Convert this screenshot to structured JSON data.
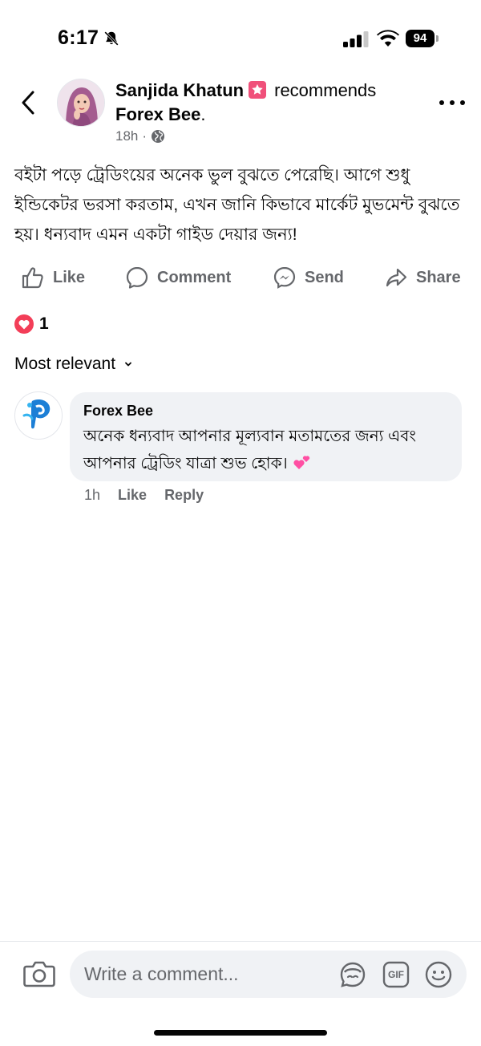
{
  "status_bar": {
    "time": "6:17",
    "battery": "94",
    "icons": [
      "bell-off-icon",
      "signal-icon",
      "wifi-icon",
      "battery-icon"
    ]
  },
  "post": {
    "author": "Sanjida Khatun",
    "action": "recommends",
    "page": "Forex Bee",
    "page_suffix": ".",
    "time": "18h",
    "separator": "·",
    "privacy_icon": "globe-icon",
    "text": "বইটা পড়ে ট্রেডিংয়ের অনেক ভুল বুঝতে পেরেছি। আগে শুধু ইন্ডিকেটর ভরসা করতাম, এখন জানি কিভাবে মার্কেট মুভমেন্ট বুঝতে হয়। ধন্যবাদ এমন একটা গাইড দেয়ার জন্য!"
  },
  "actions": {
    "like": "Like",
    "comment": "Comment",
    "send": "Send",
    "share": "Share"
  },
  "reactions": {
    "icon": "heart-icon",
    "count": "1"
  },
  "sort": {
    "label": "Most relevant"
  },
  "comments": [
    {
      "author": "Forex Bee",
      "text": "অনেক ধন্যবাদ আপনার মূল্যবান মতামতের জন্য এবং আপনার ট্রেডিং  যাত্রা শুভ হোক।",
      "emoji": "two-hearts-icon",
      "time": "1h",
      "like": "Like",
      "reply": "Reply"
    }
  ],
  "composer": {
    "placeholder": "Write a comment...",
    "gif_label": "GIF"
  },
  "colors": {
    "text": "#050505",
    "secondary": "#65676b",
    "bubble": "#f0f2f5",
    "reaction_heart": "#f33e58",
    "badge": "#f0507a",
    "brand_blue": "#1877f2"
  }
}
